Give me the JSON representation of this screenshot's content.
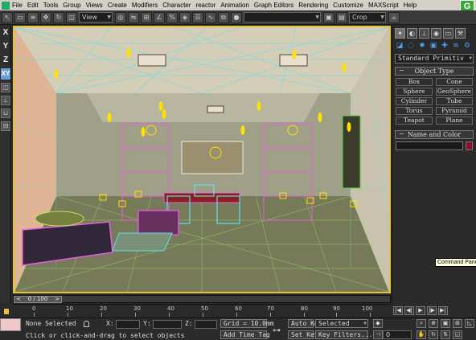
{
  "menubar": {
    "items": [
      "File",
      "Edit",
      "Tools",
      "Group",
      "Views",
      "Create",
      "Modifiers",
      "Character",
      "reactor",
      "Animation",
      "Graph Editors",
      "Rendering",
      "Customize",
      "MAXScript",
      "Help"
    ],
    "logo_letter": "G"
  },
  "toolbar": {
    "view_dropdown": "View",
    "crop_dropdown": "Crop"
  },
  "axes": [
    "X",
    "Y",
    "Z",
    "XY"
  ],
  "viewport": {
    "label": ""
  },
  "command_panel": {
    "category_dropdown": "Standard Primitiv",
    "object_type": {
      "title": "Object Type",
      "buttons": [
        "Box",
        "Cone",
        "Sphere",
        "GeoSphere",
        "Cylinder",
        "Tube",
        "Torus",
        "Pyramid",
        "Teapot",
        "Plane"
      ]
    },
    "name_and_color": {
      "title": "Name and Color",
      "name_value": "",
      "color": "#8b1030"
    },
    "tooltip": "Command Panel"
  },
  "timeline": {
    "frame_readout": "0 / 100",
    "ticks": [
      "0",
      "10",
      "20",
      "30",
      "40",
      "50",
      "60",
      "70",
      "80",
      "90",
      "100"
    ]
  },
  "status": {
    "selection": "None Selected",
    "prompt": "Click or click-and-drag to select objects",
    "x_label": "X:",
    "y_label": "Y:",
    "z_label": "Z:",
    "grid": "Grid = 10.0mm",
    "add_time_tag": "Add Time Tag",
    "auto_key": "Auto Key",
    "set_key": "Set Key",
    "key_mode": "Selected",
    "key_filters": "Key Filters...",
    "current_frame": "0"
  },
  "colors": {
    "viewport_border": "#e8c23a",
    "wireframe_cyan": "#5fe0e8",
    "wireframe_magenta": "#e85fe0",
    "light_yellow": "#ffe000"
  }
}
